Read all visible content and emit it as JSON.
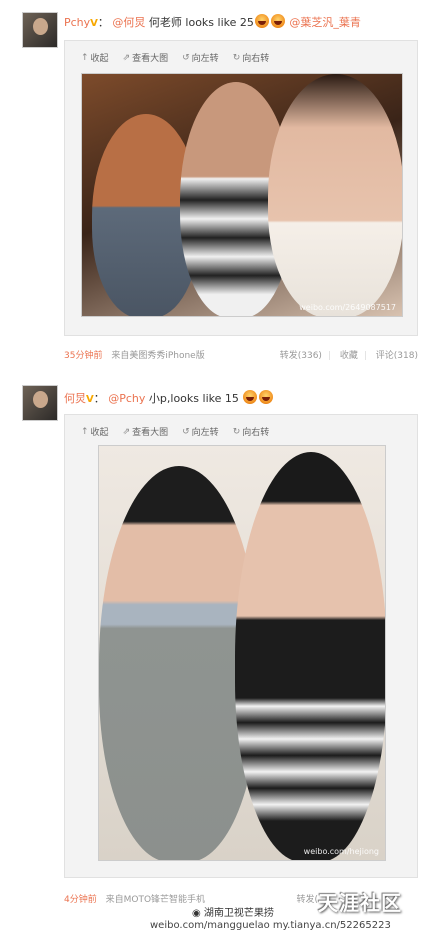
{
  "post1": {
    "author": "Pchy",
    "verified": "V",
    "mention1": "@何炅",
    "text": "何老师 looks like 25",
    "mention2": "@葉芝汎_葉青",
    "watermark": "weibo.com/2649087517",
    "time": "35分钟前",
    "source": "来自美图秀秀iPhone版",
    "repost": "转发(336)",
    "favorite": "收藏",
    "comment": "评论(318)"
  },
  "post2": {
    "author": "何炅",
    "verified": "V",
    "mention1": "@Pchy",
    "text": "小p,looks like 15",
    "watermark": "weibo.com/hejiong",
    "time": "4分钟前",
    "source": "来自MOTO锋芒智能手机",
    "repost": "转发("
  },
  "actions": {
    "collapse": "收起",
    "view_large": "查看大图",
    "rotate_left": "向左转",
    "rotate_right": "向右转"
  },
  "icons": {
    "collapse": "collapse-arrow-icon",
    "view_large": "external-link-icon",
    "rotate_left": "rotate-left-icon",
    "rotate_right": "rotate-right-icon",
    "emoji": "laughing-emoji-icon"
  },
  "overlay": {
    "brand": "天涯社区",
    "weibo_handle": "湖南卫视芒果捞",
    "url": "weibo.com/mangguelao my.tianya.cn/52265223"
  },
  "colors": {
    "link": "#eb7350",
    "muted": "#999999",
    "card_bg": "#f3f3f3"
  }
}
